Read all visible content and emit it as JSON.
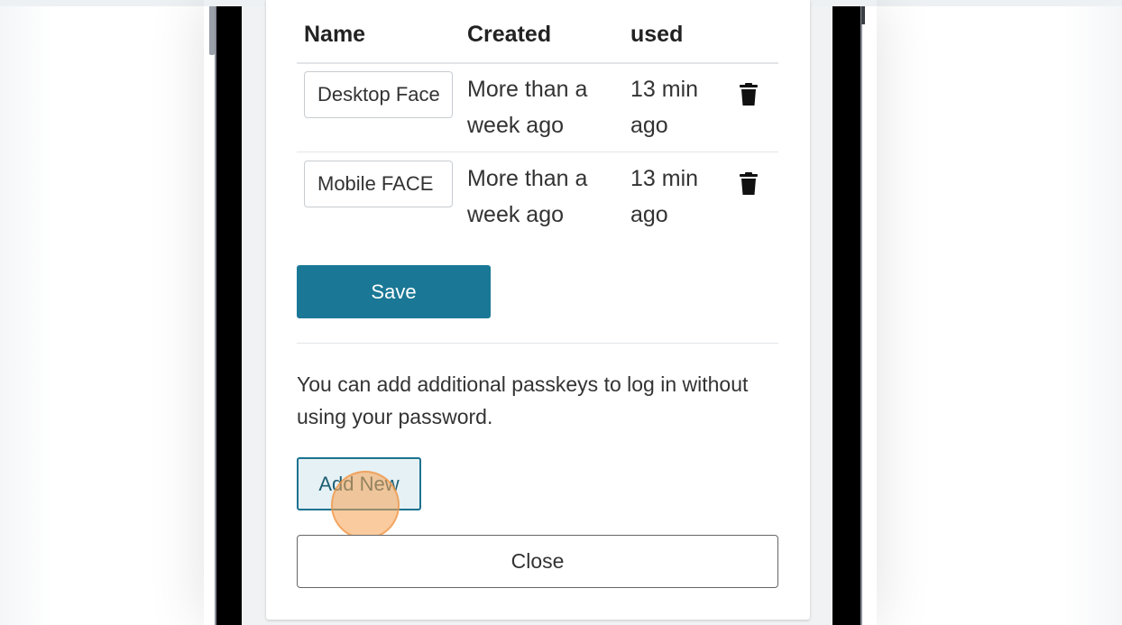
{
  "table": {
    "headers": {
      "name": "Name",
      "created": "Created",
      "used": "used"
    },
    "rows": [
      {
        "name": "Desktop Face",
        "created": "More than a week ago",
        "used": "13 min ago",
        "delete_icon": "trash-icon"
      },
      {
        "name": "Mobile FACE",
        "created": "More than a week ago",
        "used": "13 min ago",
        "delete_icon": "trash-icon"
      }
    ]
  },
  "actions": {
    "save_label": "Save",
    "add_new_label": "Add New",
    "close_label": "Close"
  },
  "info_text": "You can add additional passkeys to log in without using your password.",
  "colors": {
    "primary": "#1a7896",
    "add_new_bg": "#e6f1f5",
    "add_new_border": "#1d7390",
    "text": "#333333",
    "click_highlight": "#f5a050"
  }
}
